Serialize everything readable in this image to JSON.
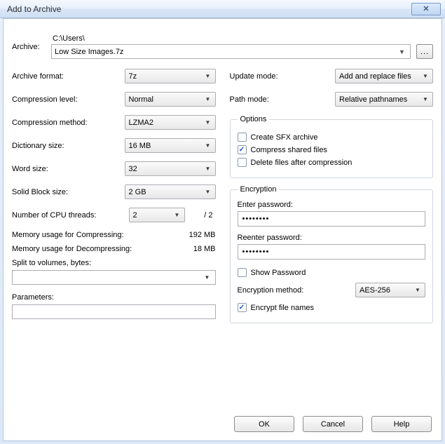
{
  "window": {
    "title": "Add to Archive",
    "close_x": "✕"
  },
  "archive": {
    "label": "Archive:",
    "path": "C:\\Users\\",
    "filename": "Low Size Images.7z",
    "browse": "..."
  },
  "left": {
    "format": {
      "label": "Archive format:",
      "value": "7z"
    },
    "level": {
      "label": "Compression level:",
      "value": "Normal"
    },
    "method": {
      "label": "Compression method:",
      "value": "LZMA2"
    },
    "dict": {
      "label": "Dictionary size:",
      "value": "16 MB"
    },
    "word": {
      "label": "Word size:",
      "value": "32"
    },
    "solid": {
      "label": "Solid Block size:",
      "value": "2 GB"
    },
    "cpu": {
      "label": "Number of CPU threads:",
      "value": "2",
      "total": "/ 2"
    },
    "mem_comp": {
      "label": "Memory usage for Compressing:",
      "value": "192 MB"
    },
    "mem_decomp": {
      "label": "Memory usage for Decompressing:",
      "value": "18 MB"
    },
    "split": {
      "label": "Split to volumes, bytes:",
      "value": ""
    },
    "params": {
      "label": "Parameters:",
      "value": ""
    }
  },
  "right": {
    "update": {
      "label": "Update mode:",
      "value": "Add and replace files"
    },
    "pathmode": {
      "label": "Path mode:",
      "value": "Relative pathnames"
    },
    "options": {
      "legend": "Options",
      "sfx": {
        "label": "Create SFX archive",
        "checked": false
      },
      "shared": {
        "label": "Compress shared files",
        "checked": true
      },
      "delete": {
        "label": "Delete files after compression",
        "checked": false
      }
    },
    "encryption": {
      "legend": "Encryption",
      "enter": "Enter password:",
      "reenter": "Reenter password:",
      "mask": "••••••••",
      "show": {
        "label": "Show Password",
        "checked": false
      },
      "method": {
        "label": "Encryption method:",
        "value": "AES-256"
      },
      "encrypt_names": {
        "label": "Encrypt file names",
        "checked": true
      }
    }
  },
  "buttons": {
    "ok": "OK",
    "cancel": "Cancel",
    "help": "Help"
  }
}
